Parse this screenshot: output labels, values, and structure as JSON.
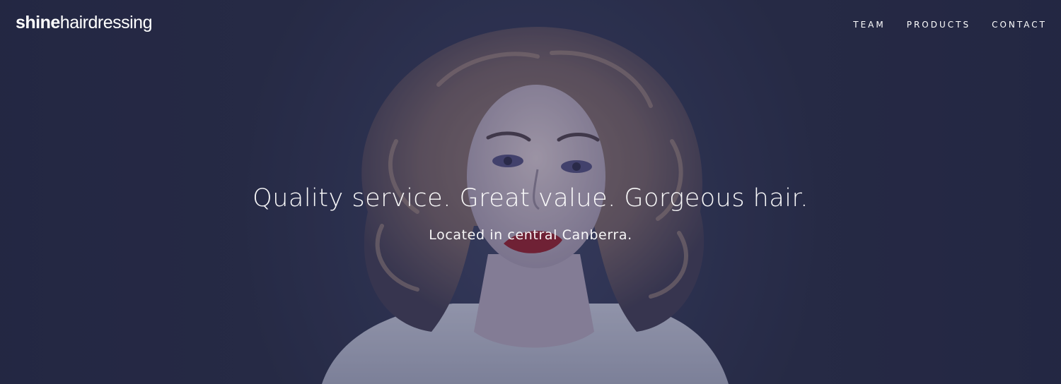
{
  "brand": {
    "logo_bold": "shine",
    "logo_light": "hairdressing"
  },
  "nav": {
    "items": [
      {
        "label": "TEAM"
      },
      {
        "label": "PRODUCTS"
      },
      {
        "label": "CONTACT"
      }
    ]
  },
  "hero": {
    "headline": "Quality service. Great value. Gorgeous hair.",
    "subheadline": "Located in central Canberra."
  },
  "colors": {
    "background": "#2a2f4a",
    "text": "#ffffff",
    "lip_accent": "#8b1e2e"
  }
}
